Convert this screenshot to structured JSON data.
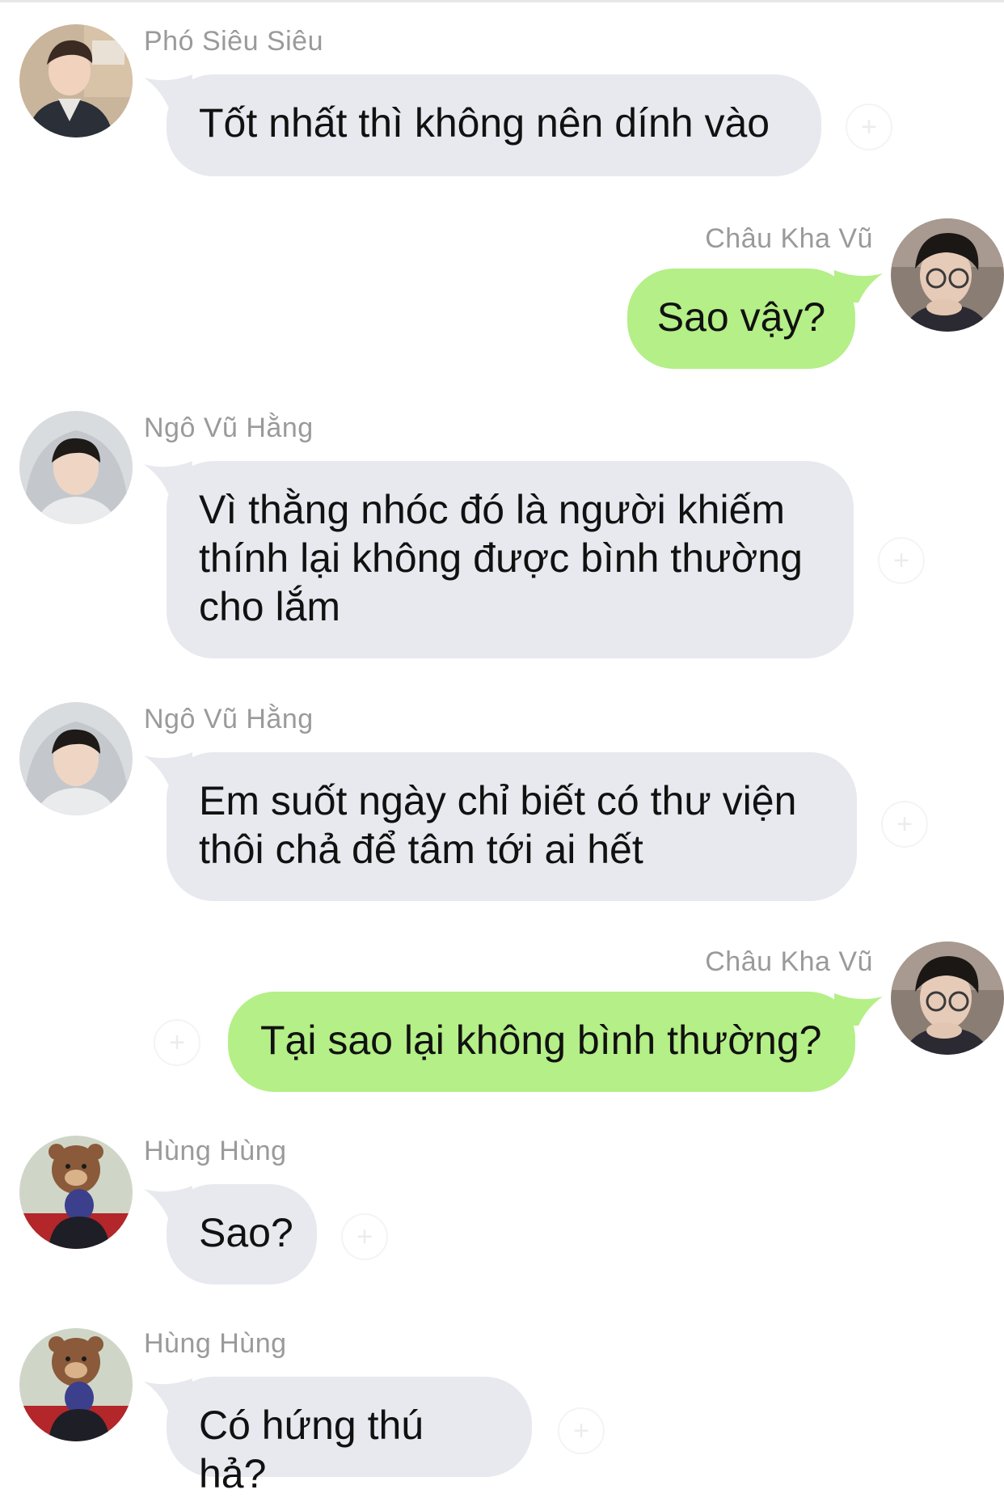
{
  "colors": {
    "incoming_bubble": "#e8e9ee",
    "outgoing_bubble": "#b4ef87",
    "sender_name": "#9a9a9a",
    "text": "#111111"
  },
  "messages": [
    {
      "sender": "Phó Siêu Siêu",
      "text": "Tốt nhất thì không nên dính vào",
      "direction": "incoming",
      "avatar": "avatar-pho-sieu-sieu"
    },
    {
      "sender": "Châu Kha Vũ",
      "text": "Sao vậy?",
      "direction": "outgoing",
      "avatar": "avatar-chau-kha-vu"
    },
    {
      "sender": "Ngô Vũ Hằng",
      "text_lines": [
        "Vì thằng nhóc đó là người khiếm",
        "thính lại không được bình thường",
        "cho lắm"
      ],
      "direction": "incoming",
      "avatar": "avatar-ngo-vu-hang"
    },
    {
      "sender": "Ngô Vũ Hằng",
      "text_lines": [
        "Em suốt ngày chỉ biết có thư viện",
        "thôi chả để tâm tới ai hết"
      ],
      "direction": "incoming",
      "avatar": "avatar-ngo-vu-hang"
    },
    {
      "sender": "Châu Kha Vũ",
      "text": "Tại sao lại không bình thường?",
      "direction": "outgoing",
      "avatar": "avatar-chau-kha-vu"
    },
    {
      "sender": "Hùng Hùng",
      "text": "Sao?",
      "direction": "incoming",
      "avatar": "avatar-hung-hung"
    },
    {
      "sender": "Hùng Hùng",
      "text": "Có hứng thú hả?",
      "direction": "incoming",
      "avatar": "avatar-hung-hung"
    }
  ],
  "reaction_icon": "add-reaction-icon"
}
